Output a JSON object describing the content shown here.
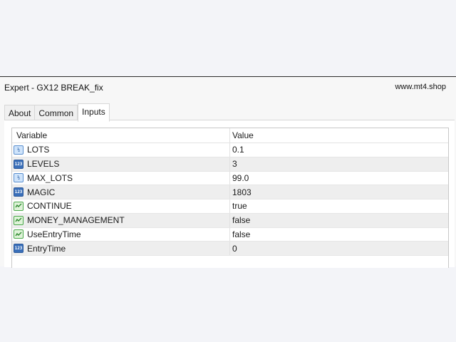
{
  "window": {
    "title": "Expert - GX12 BREAK_fix",
    "site": "www.mt4.shop"
  },
  "tabs": [
    {
      "label": "About"
    },
    {
      "label": "Common"
    },
    {
      "label": "Inputs"
    }
  ],
  "active_tab": "Inputs",
  "grid": {
    "columns": [
      "Variable",
      "Value"
    ],
    "rows": [
      {
        "variable": "LOTS",
        "value": "0.1",
        "type_icon": "double-icon"
      },
      {
        "variable": "LEVELS",
        "value": "3",
        "type_icon": "integer-icon"
      },
      {
        "variable": "MAX_LOTS",
        "value": "99.0",
        "type_icon": "double-icon"
      },
      {
        "variable": "MAGIC",
        "value": "1803",
        "type_icon": "integer-icon"
      },
      {
        "variable": "CONTINUE",
        "value": "true",
        "type_icon": "bool-icon"
      },
      {
        "variable": "MONEY_MANAGEMENT",
        "value": "false",
        "type_icon": "bool-icon"
      },
      {
        "variable": "UseEntryTime",
        "value": "false",
        "type_icon": "bool-icon"
      },
      {
        "variable": "EntryTime",
        "value": "0",
        "type_icon": "integer-icon"
      }
    ]
  },
  "icon_glyphs": {
    "double-icon": "½",
    "integer-icon": "123"
  },
  "colors": {
    "alt_row": "#eeeeee",
    "double_icon": "#5a8fce",
    "integer_icon": "#3a6fb9",
    "bool_icon": "#4aa84a"
  }
}
